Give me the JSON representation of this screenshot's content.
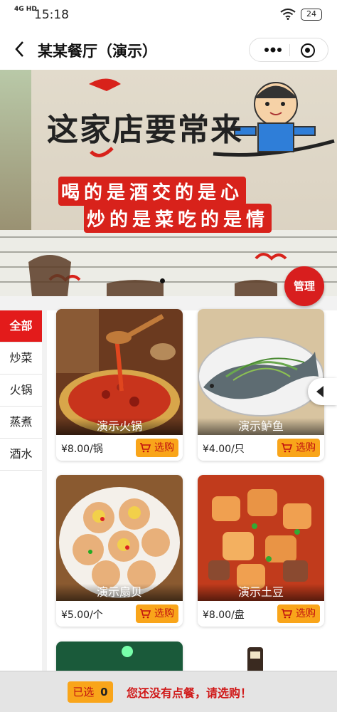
{
  "status_bar": {
    "network": "4G HD",
    "time": "15:18",
    "battery": "24"
  },
  "navbar": {
    "back_icon": "chevron-left-icon",
    "title": "某某餐厅（演示）",
    "more_icon": "more-dots-icon",
    "close_icon": "target-circle-icon"
  },
  "banner": {
    "sign_line1": "这家店要常来",
    "sign_line2": "喝的是酒交的是心",
    "sign_line3": "炒的是菜吃的是情",
    "manage_label": "管理"
  },
  "sidebar": {
    "categories": [
      {
        "label": "全部",
        "active": true
      },
      {
        "label": "炒菜",
        "active": false
      },
      {
        "label": "火锅",
        "active": false
      },
      {
        "label": "蒸煮",
        "active": false
      },
      {
        "label": "酒水",
        "active": false
      }
    ]
  },
  "products": [
    {
      "name": "演示火锅",
      "price": "¥8.00/锅",
      "buy_label": "选购"
    },
    {
      "name": "演示鲈鱼",
      "price": "¥4.00/只",
      "buy_label": "选购"
    },
    {
      "name": "演示扇贝",
      "price": "¥5.00/个",
      "buy_label": "选购"
    },
    {
      "name": "演示土豆",
      "price": "¥8.00/盘",
      "buy_label": "选购"
    }
  ],
  "bottom_bar": {
    "selected_label": "已选",
    "selected_count": "0",
    "message": "您还没有点餐，请选购！"
  },
  "colors": {
    "accent_red": "#e31b1b",
    "button_orange": "#f9a51a"
  }
}
